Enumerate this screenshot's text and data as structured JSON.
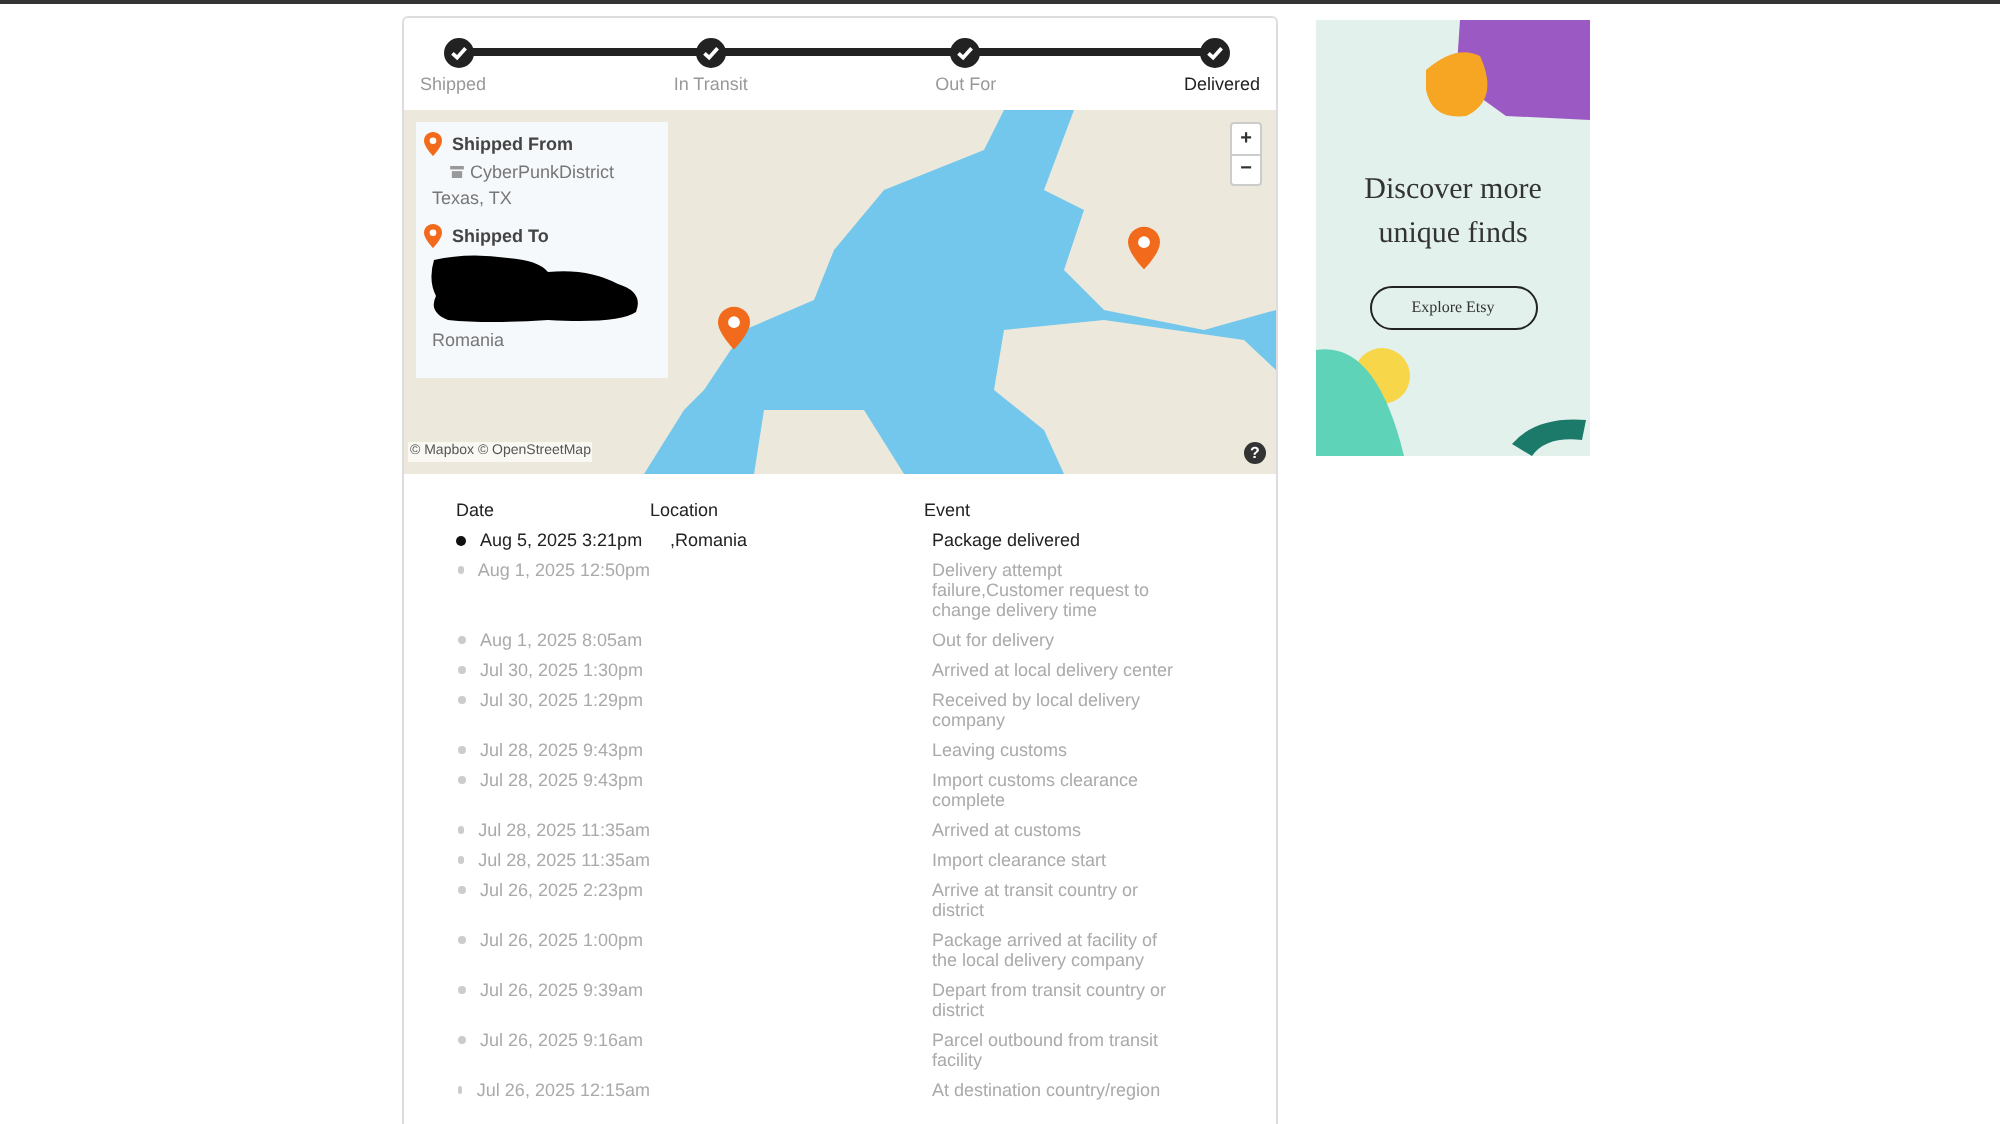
{
  "progress": {
    "steps": [
      {
        "label": "Shipped",
        "done": true,
        "selected": false
      },
      {
        "label": "In Transit",
        "done": true,
        "selected": false
      },
      {
        "label": "Out For",
        "done": true,
        "selected": false
      },
      {
        "label": "Delivered",
        "done": true,
        "selected": true
      }
    ]
  },
  "map": {
    "origin": {
      "title": "Shipped From",
      "shop": "CyberPunkDistrict",
      "place": "Texas, TX"
    },
    "destination": {
      "title": "Shipped To",
      "redacted": true,
      "country": "Romania"
    },
    "zoom_in": "+",
    "zoom_out": "−",
    "attribution": "© Mapbox © OpenStreetMap",
    "help": "?"
  },
  "table": {
    "columns": [
      "Date",
      "Location",
      "Event"
    ],
    "rows": [
      {
        "date": "Aug 5, 2025 3:21pm",
        "location": ",Romania",
        "event": "Package delivered",
        "current": true
      },
      {
        "date": "Aug 1, 2025 12:50pm",
        "event": "Delivery attempt failure,Customer request to change delivery time",
        "current": false
      },
      {
        "date": "Aug 1, 2025 8:05am",
        "event": "Out for delivery",
        "current": false
      },
      {
        "date": "Jul 30, 2025 1:30pm",
        "event": "Arrived at local delivery center",
        "current": false
      },
      {
        "date": "Jul 30, 2025 1:29pm",
        "event": "Received by local delivery company",
        "current": false
      },
      {
        "date": "Jul 28, 2025 9:43pm",
        "event": "Leaving customs",
        "current": false
      },
      {
        "date": "Jul 28, 2025 9:43pm",
        "event": "Import customs clearance complete",
        "current": false
      },
      {
        "date": "Jul 28, 2025 11:35am",
        "event": "Arrived at customs",
        "current": false
      },
      {
        "date": "Jul 28, 2025 11:35am",
        "event": "Import clearance start",
        "current": false
      },
      {
        "date": "Jul 26, 2025 2:23pm",
        "event": "Arrive at transit country or district",
        "current": false
      },
      {
        "date": "Jul 26, 2025 1:00pm",
        "event": "Package arrived at facility of the local delivery company",
        "current": false
      },
      {
        "date": "Jul 26, 2025 9:39am",
        "event": "Depart from transit country or district",
        "current": false
      },
      {
        "date": "Jul 26, 2025 9:16am",
        "event": "Parcel outbound from transit facility",
        "current": false
      },
      {
        "date": "Jul 26, 2025 12:15am",
        "event": "At destination country/region",
        "current": false
      }
    ]
  },
  "ad": {
    "headline": "Discover more unique finds",
    "button": "Explore Etsy"
  }
}
